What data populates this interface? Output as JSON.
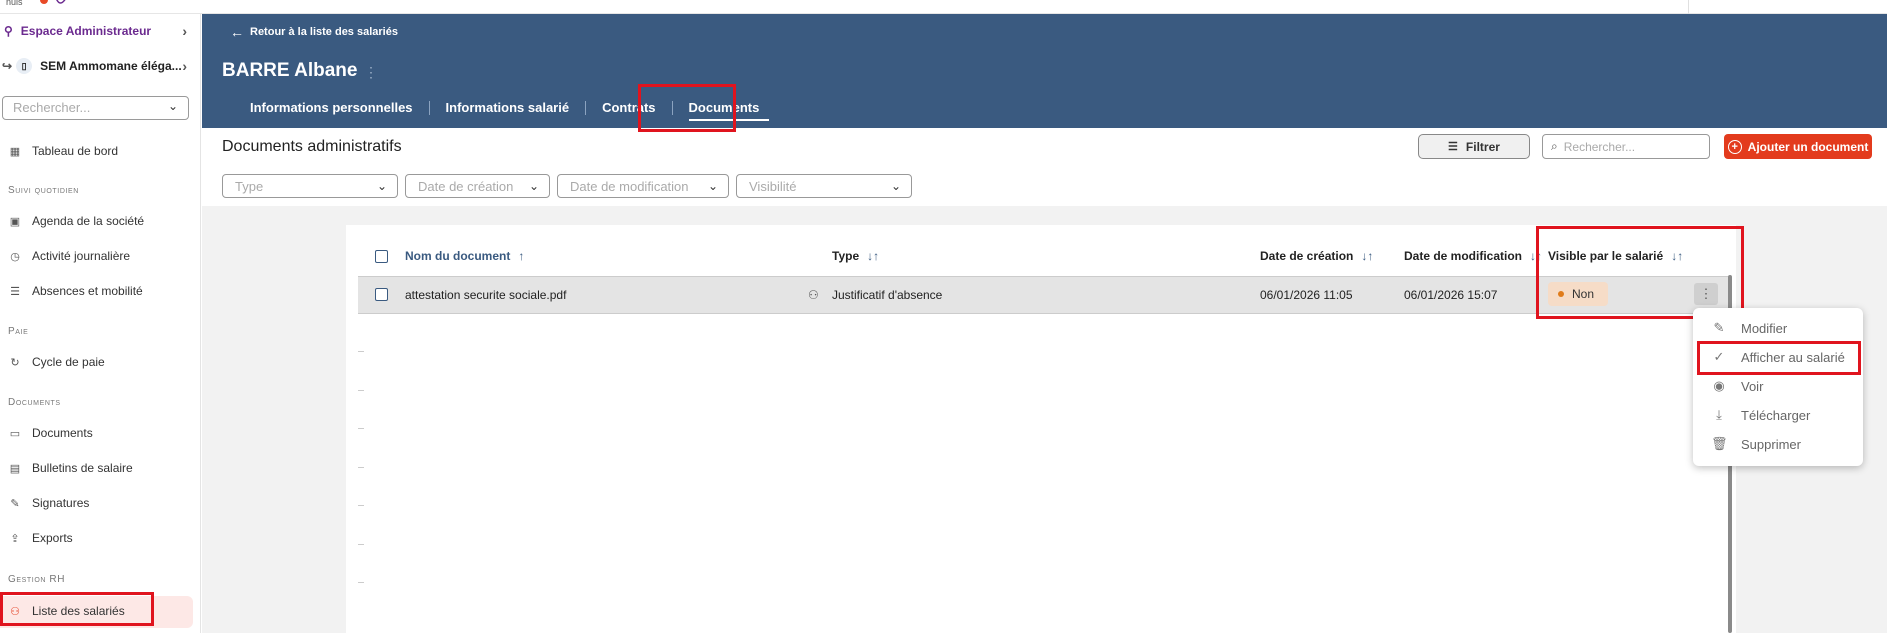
{
  "sidebar": {
    "admin_label": "Espace Administrateur",
    "company_label": "SEM Ammomane éléga...",
    "search_placeholder": "Rechercher...",
    "dashboard": "Tableau de bord",
    "section_daily": "Suivi quotidien",
    "agenda": "Agenda de la société",
    "activity": "Activité journalière",
    "absences": "Absences et mobilité",
    "section_pay": "Paie",
    "pay_cycle": "Cycle de paie",
    "section_documents": "Documents",
    "documents": "Documents",
    "payslips": "Bulletins de salaire",
    "signatures": "Signatures",
    "exports": "Exports",
    "section_hr": "Gestion RH",
    "employees": "Liste des salariés"
  },
  "header": {
    "back_label": "Retour à la liste des salariés",
    "employee_name": "BARRE Albane",
    "tabs": [
      "Informations personnelles",
      "Informations salarié",
      "Contrats",
      "Documents"
    ]
  },
  "toolbar": {
    "title": "Documents administratifs",
    "filter_label": "Filtrer",
    "search_placeholder": "Rechercher...",
    "add_label": "Ajouter un document"
  },
  "filters": {
    "type": "Type",
    "created": "Date de création",
    "modified": "Date de modification",
    "visibility": "Visibilité"
  },
  "table": {
    "columns": [
      "Nom du document",
      "Type",
      "Date de création",
      "Date de modification",
      "Visible par le salarié"
    ],
    "rows": [
      {
        "name": "attestation securite sociale.pdf",
        "type": "Justificatif d'absence",
        "created": "06/01/2026 11:05",
        "modified": "06/01/2026 15:07",
        "visible": "Non"
      }
    ]
  },
  "menu": {
    "items": [
      "Modifier",
      "Afficher au salarié",
      "Voir",
      "Télécharger",
      "Supprimer"
    ]
  },
  "colors": {
    "header_bg": "#3a5a80",
    "accent_red": "#e33b1d",
    "highlight": "#e0141e",
    "badge_bg": "#f6dcc7"
  }
}
